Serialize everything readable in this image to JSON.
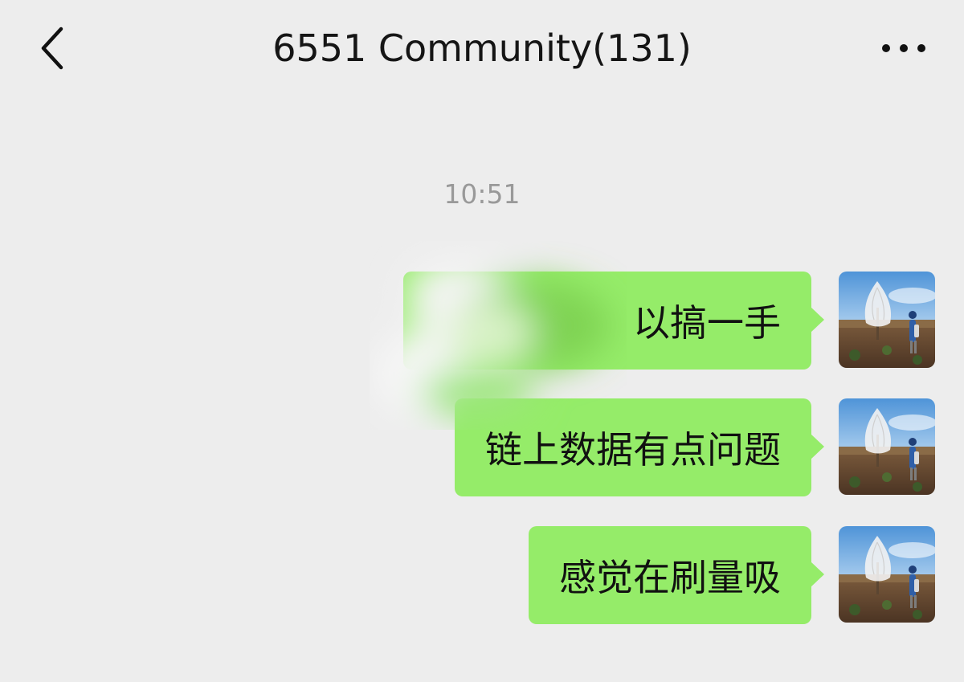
{
  "header": {
    "title": "6551 Community(131)",
    "back_icon": "chevron-left-icon",
    "more_icon": "more-dots-icon"
  },
  "chat": {
    "timestamp": "10:51",
    "messages": [
      {
        "text": "以搞一手",
        "sender": "self"
      },
      {
        "text": "链上数据有点问题",
        "sender": "self"
      },
      {
        "text": "感觉在刷量吸",
        "sender": "self"
      }
    ]
  },
  "colors": {
    "background": "#ededed",
    "bubble_self": "#95ec69",
    "timestamp": "#999999"
  }
}
